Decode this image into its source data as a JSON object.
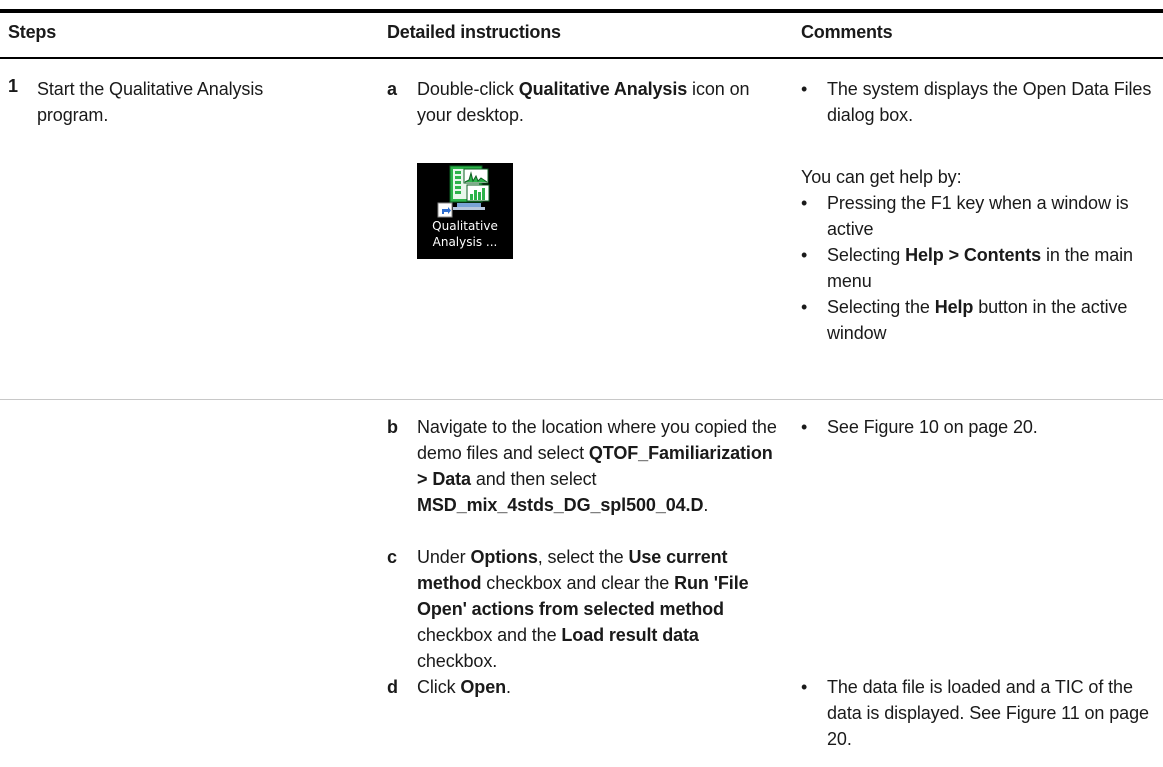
{
  "headers": {
    "steps": "Steps",
    "detailed": "Detailed instructions",
    "comments": "Comments"
  },
  "step1": {
    "number": "1",
    "text": "Start the Qualitative Analysis program."
  },
  "a": {
    "letter": "a",
    "pre": "Double-click ",
    "bold": "Qualitative Analysis",
    "post": " icon on your desktop.",
    "icon_label_line1": "Qualitative",
    "icon_label_line2": "Analysis ..."
  },
  "comments_a": {
    "bullet": "•",
    "text": "The system displays the Open Data Files dialog box.",
    "help_intro": "You can get help by:",
    "help_1": "Pressing the F1 key when a window is active",
    "help_2_pre": "Selecting ",
    "help_2_bold": "Help > Contents",
    "help_2_post": " in the main menu",
    "help_3_pre": "Selecting the ",
    "help_3_bold": "Help",
    "help_3_post": " button in the active window"
  },
  "b": {
    "letter": "b",
    "t1": "Navigate to the location where you copied the demo files and select ",
    "b1": "QTOF_Familiarization > Data",
    "t2": " and then select ",
    "b2": "MSD_mix_4stds_DG_spl500_04.D",
    "t3": "."
  },
  "comments_b": {
    "text": "See Figure 10 on page 20."
  },
  "c": {
    "letter": "c",
    "t1": "Under ",
    "b1": "Options",
    "t2": ", select the ",
    "b2": "Use current method",
    "t3": " checkbox and clear the ",
    "b3": "Run 'File Open' actions from selected method",
    "t4": " checkbox and the ",
    "b4": "Load result data",
    "t5": " checkbox."
  },
  "d": {
    "letter": "d",
    "t1": "Click ",
    "b1": "Open",
    "t2": "."
  },
  "comments_d": {
    "text": "The data file is loaded and a TIC of the data is displayed. See Figure 11 on page 20."
  },
  "colors": {
    "icon_bg": "#000000",
    "icon_green": "#2db34a",
    "shortcut_blue": "#2f6fd0"
  }
}
